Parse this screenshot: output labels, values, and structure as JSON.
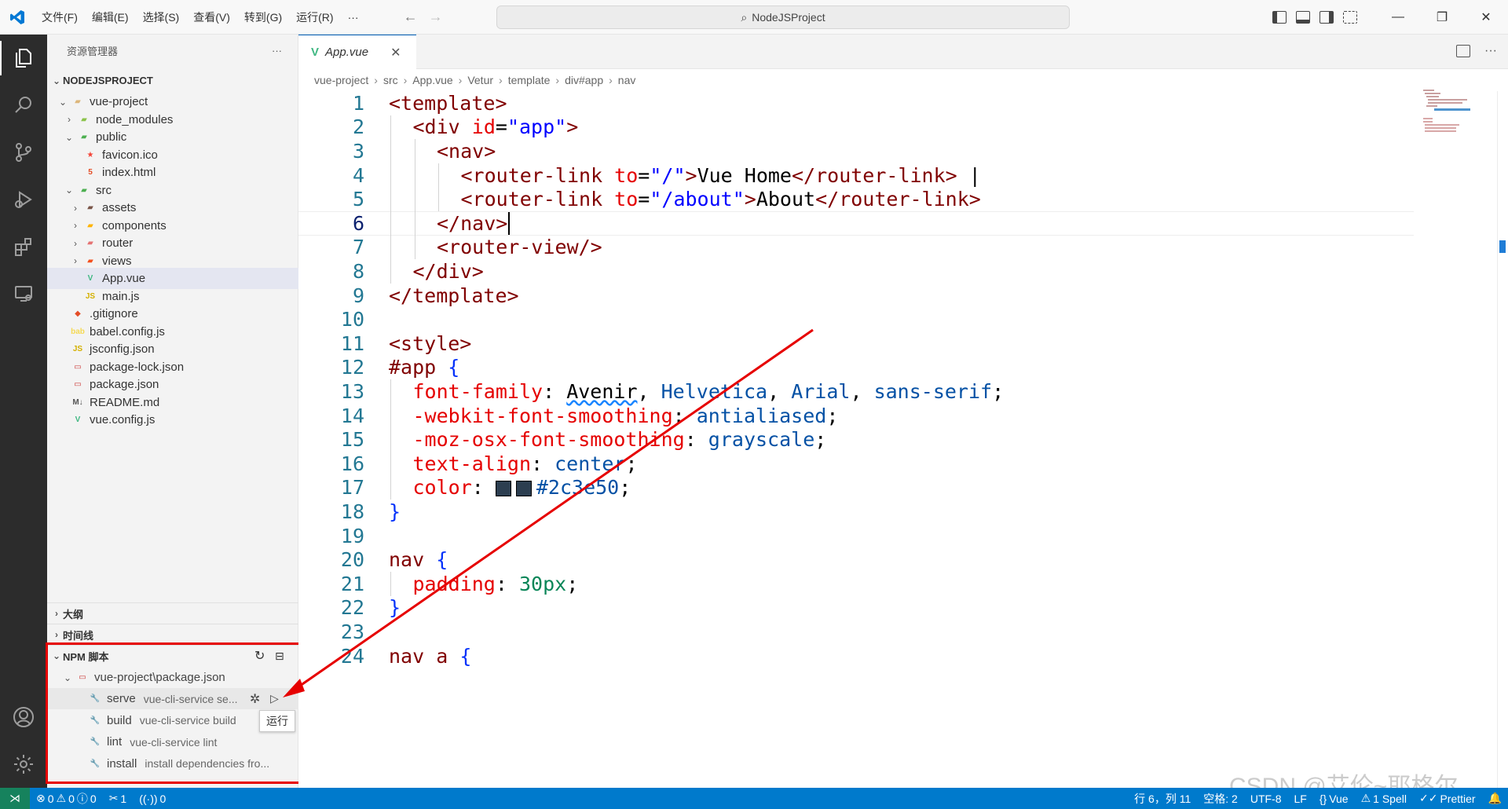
{
  "titlebar": {
    "menus": [
      "文件(F)",
      "编辑(E)",
      "选择(S)",
      "查看(V)",
      "转到(G)",
      "运行(R)",
      "···"
    ],
    "search": "NodeJSProject"
  },
  "explorer": {
    "title": "资源管理器",
    "more": "···",
    "root": "NODEJSPROJECT",
    "items": [
      {
        "label": "vue-project",
        "chev": "v",
        "icon": "folder-icon"
      },
      {
        "label": "node_modules",
        "chev": ">",
        "icon": "folder-node-icon"
      },
      {
        "label": "public",
        "chev": "v",
        "icon": "folder-public-icon"
      },
      {
        "label": "favicon.ico",
        "chev": "",
        "icon": "favicon-file-icon"
      },
      {
        "label": "index.html",
        "chev": "",
        "icon": "html-file-icon"
      },
      {
        "label": "src",
        "chev": "v",
        "icon": "folder-src-icon"
      },
      {
        "label": "assets",
        "chev": ">",
        "icon": "folder-assets-icon"
      },
      {
        "label": "components",
        "chev": ">",
        "icon": "folder-components-icon"
      },
      {
        "label": "router",
        "chev": ">",
        "icon": "folder-router-icon"
      },
      {
        "label": "views",
        "chev": ">",
        "icon": "folder-views-icon"
      },
      {
        "label": "App.vue",
        "chev": "",
        "icon": "vue-file-icon"
      },
      {
        "label": "main.js",
        "chev": "",
        "icon": "js-file-icon"
      },
      {
        "label": ".gitignore",
        "chev": "",
        "icon": "git-file-icon"
      },
      {
        "label": "babel.config.js",
        "chev": "",
        "icon": "babel-file-icon"
      },
      {
        "label": "jsconfig.json",
        "chev": "",
        "icon": "js-file-icon"
      },
      {
        "label": "package-lock.json",
        "chev": "",
        "icon": "npm-file-icon"
      },
      {
        "label": "package.json",
        "chev": "",
        "icon": "npm-file-icon"
      },
      {
        "label": "README.md",
        "chev": "",
        "icon": "markdown-file-icon"
      },
      {
        "label": "vue.config.js",
        "chev": "",
        "icon": "vue-file-icon"
      }
    ]
  },
  "sections": {
    "outline": "大纲",
    "timeline": "时间线",
    "npm": "NPM 脚本"
  },
  "npm": {
    "package": "vue-project\\package.json",
    "scripts": [
      {
        "name": "serve",
        "cmd": "vue-cli-service se..."
      },
      {
        "name": "build",
        "cmd": "vue-cli-service build"
      },
      {
        "name": "lint",
        "cmd": "vue-cli-service lint"
      },
      {
        "name": "install",
        "cmd": "install dependencies fro..."
      }
    ],
    "tooltip": "运行"
  },
  "editor": {
    "tab": "App.vue",
    "breadcrumb": [
      "vue-project",
      "src",
      "App.vue",
      "Vetur",
      "template",
      "div#app",
      "nav"
    ],
    "lines": [
      "1",
      "2",
      "3",
      "4",
      "5",
      "6",
      "7",
      "8",
      "9",
      "10",
      "11",
      "12",
      "13",
      "14",
      "15",
      "16",
      "17",
      "18",
      "19",
      "20",
      "21",
      "22",
      "23",
      "24"
    ]
  },
  "code": {
    "l1": "<template>",
    "l2a": "<div ",
    "l2b": "id",
    "l2c": "=",
    "l2d": "\"app\"",
    "l2e": ">",
    "l3": "<nav>",
    "l4a": "<router-link ",
    "l4b": "to",
    "l4c": "=",
    "l4d": "\"/\"",
    "l4e": ">",
    "l4f": "Vue Home",
    "l4g": "</router-link>",
    "l4h": " |",
    "l5a": "<router-link ",
    "l5b": "to",
    "l5c": "=",
    "l5d": "\"/about\"",
    "l5e": ">",
    "l5f": "About",
    "l5g": "</router-link>",
    "l6": "</nav>",
    "l7": "<router-view/>",
    "l8": "</div>",
    "l9": "</template>",
    "l11": "<style>",
    "l12a": "#app ",
    "l12b": "{",
    "l13a": "font-family",
    "l13b": ": ",
    "l13c": "Avenir",
    "l13d": ", ",
    "l13e": "Helvetica",
    "l13f": ", ",
    "l13g": "Arial",
    "l13h": ", ",
    "l13i": "sans-serif",
    "l13j": ";",
    "l14a": "-webkit-font-smoothing",
    "l14b": ": ",
    "l14c": "antialiased",
    "l14d": ";",
    "l15a": "-moz-osx-font-smoothing",
    "l15b": ": ",
    "l15c": "grayscale",
    "l15d": ";",
    "l16a": "text-align",
    "l16b": ": ",
    "l16c": "center",
    "l16d": ";",
    "l17a": "color",
    "l17b": ": ",
    "l17c": "#2c3e50",
    "l17d": ";",
    "l18": "}",
    "l20a": "nav ",
    "l20b": "{",
    "l21a": "padding",
    "l21b": ": ",
    "l21c": "30px",
    "l21d": ";",
    "l22": "}",
    "l24a": "nav a ",
    "l24b": "{"
  },
  "statusbar": {
    "errors": "0",
    "warnings": "0",
    "infos": "0",
    "ports": "1",
    "live": "0",
    "position": "行 6，列 11",
    "spaces": "空格: 2",
    "encoding": "UTF-8",
    "eol": "LF",
    "language": "Vue",
    "spell": "1 Spell",
    "prettier": "Prettier"
  },
  "watermark": "CSDN @艾伦~耶格尔",
  "colors": {
    "accent": "#007acc",
    "annotation": "#e60000",
    "swatch": "#2c3e50"
  }
}
